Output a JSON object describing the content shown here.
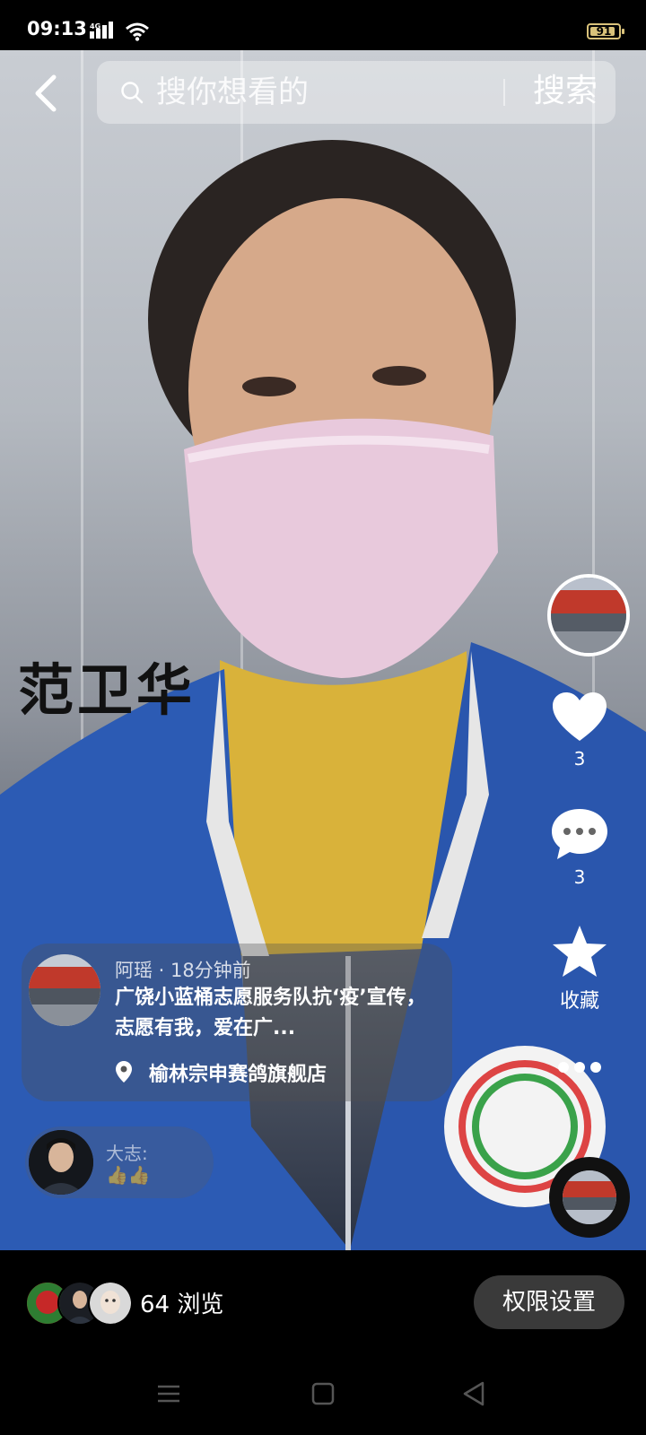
{
  "status_bar": {
    "time": "09:13",
    "network": "4G",
    "battery": "91",
    "battery_level": 0.91
  },
  "search": {
    "placeholder": "搜你想看的",
    "button": "搜索"
  },
  "video": {
    "overlay_name": "范卫华"
  },
  "rail": {
    "likes": "3",
    "comments": "3",
    "favorite_label": "收藏"
  },
  "post": {
    "meta": "阿瑶 · 18分钟前",
    "title": "广饶小蓝桶志愿服务队抗‘疫’宣传，志愿有我，爱在广...",
    "location": "榆林宗申赛鸽旗舰店"
  },
  "comment": {
    "user": "大志:",
    "text": "👍👍"
  },
  "bottom": {
    "views": "64 浏览",
    "permission_button": "权限设置"
  },
  "icons": {
    "back": "chevron-left-icon",
    "search": "search-icon",
    "like": "heart-icon",
    "comment": "comment-icon",
    "favorite": "star-icon",
    "more": "more-dots-icon",
    "location": "location-pin-icon"
  }
}
